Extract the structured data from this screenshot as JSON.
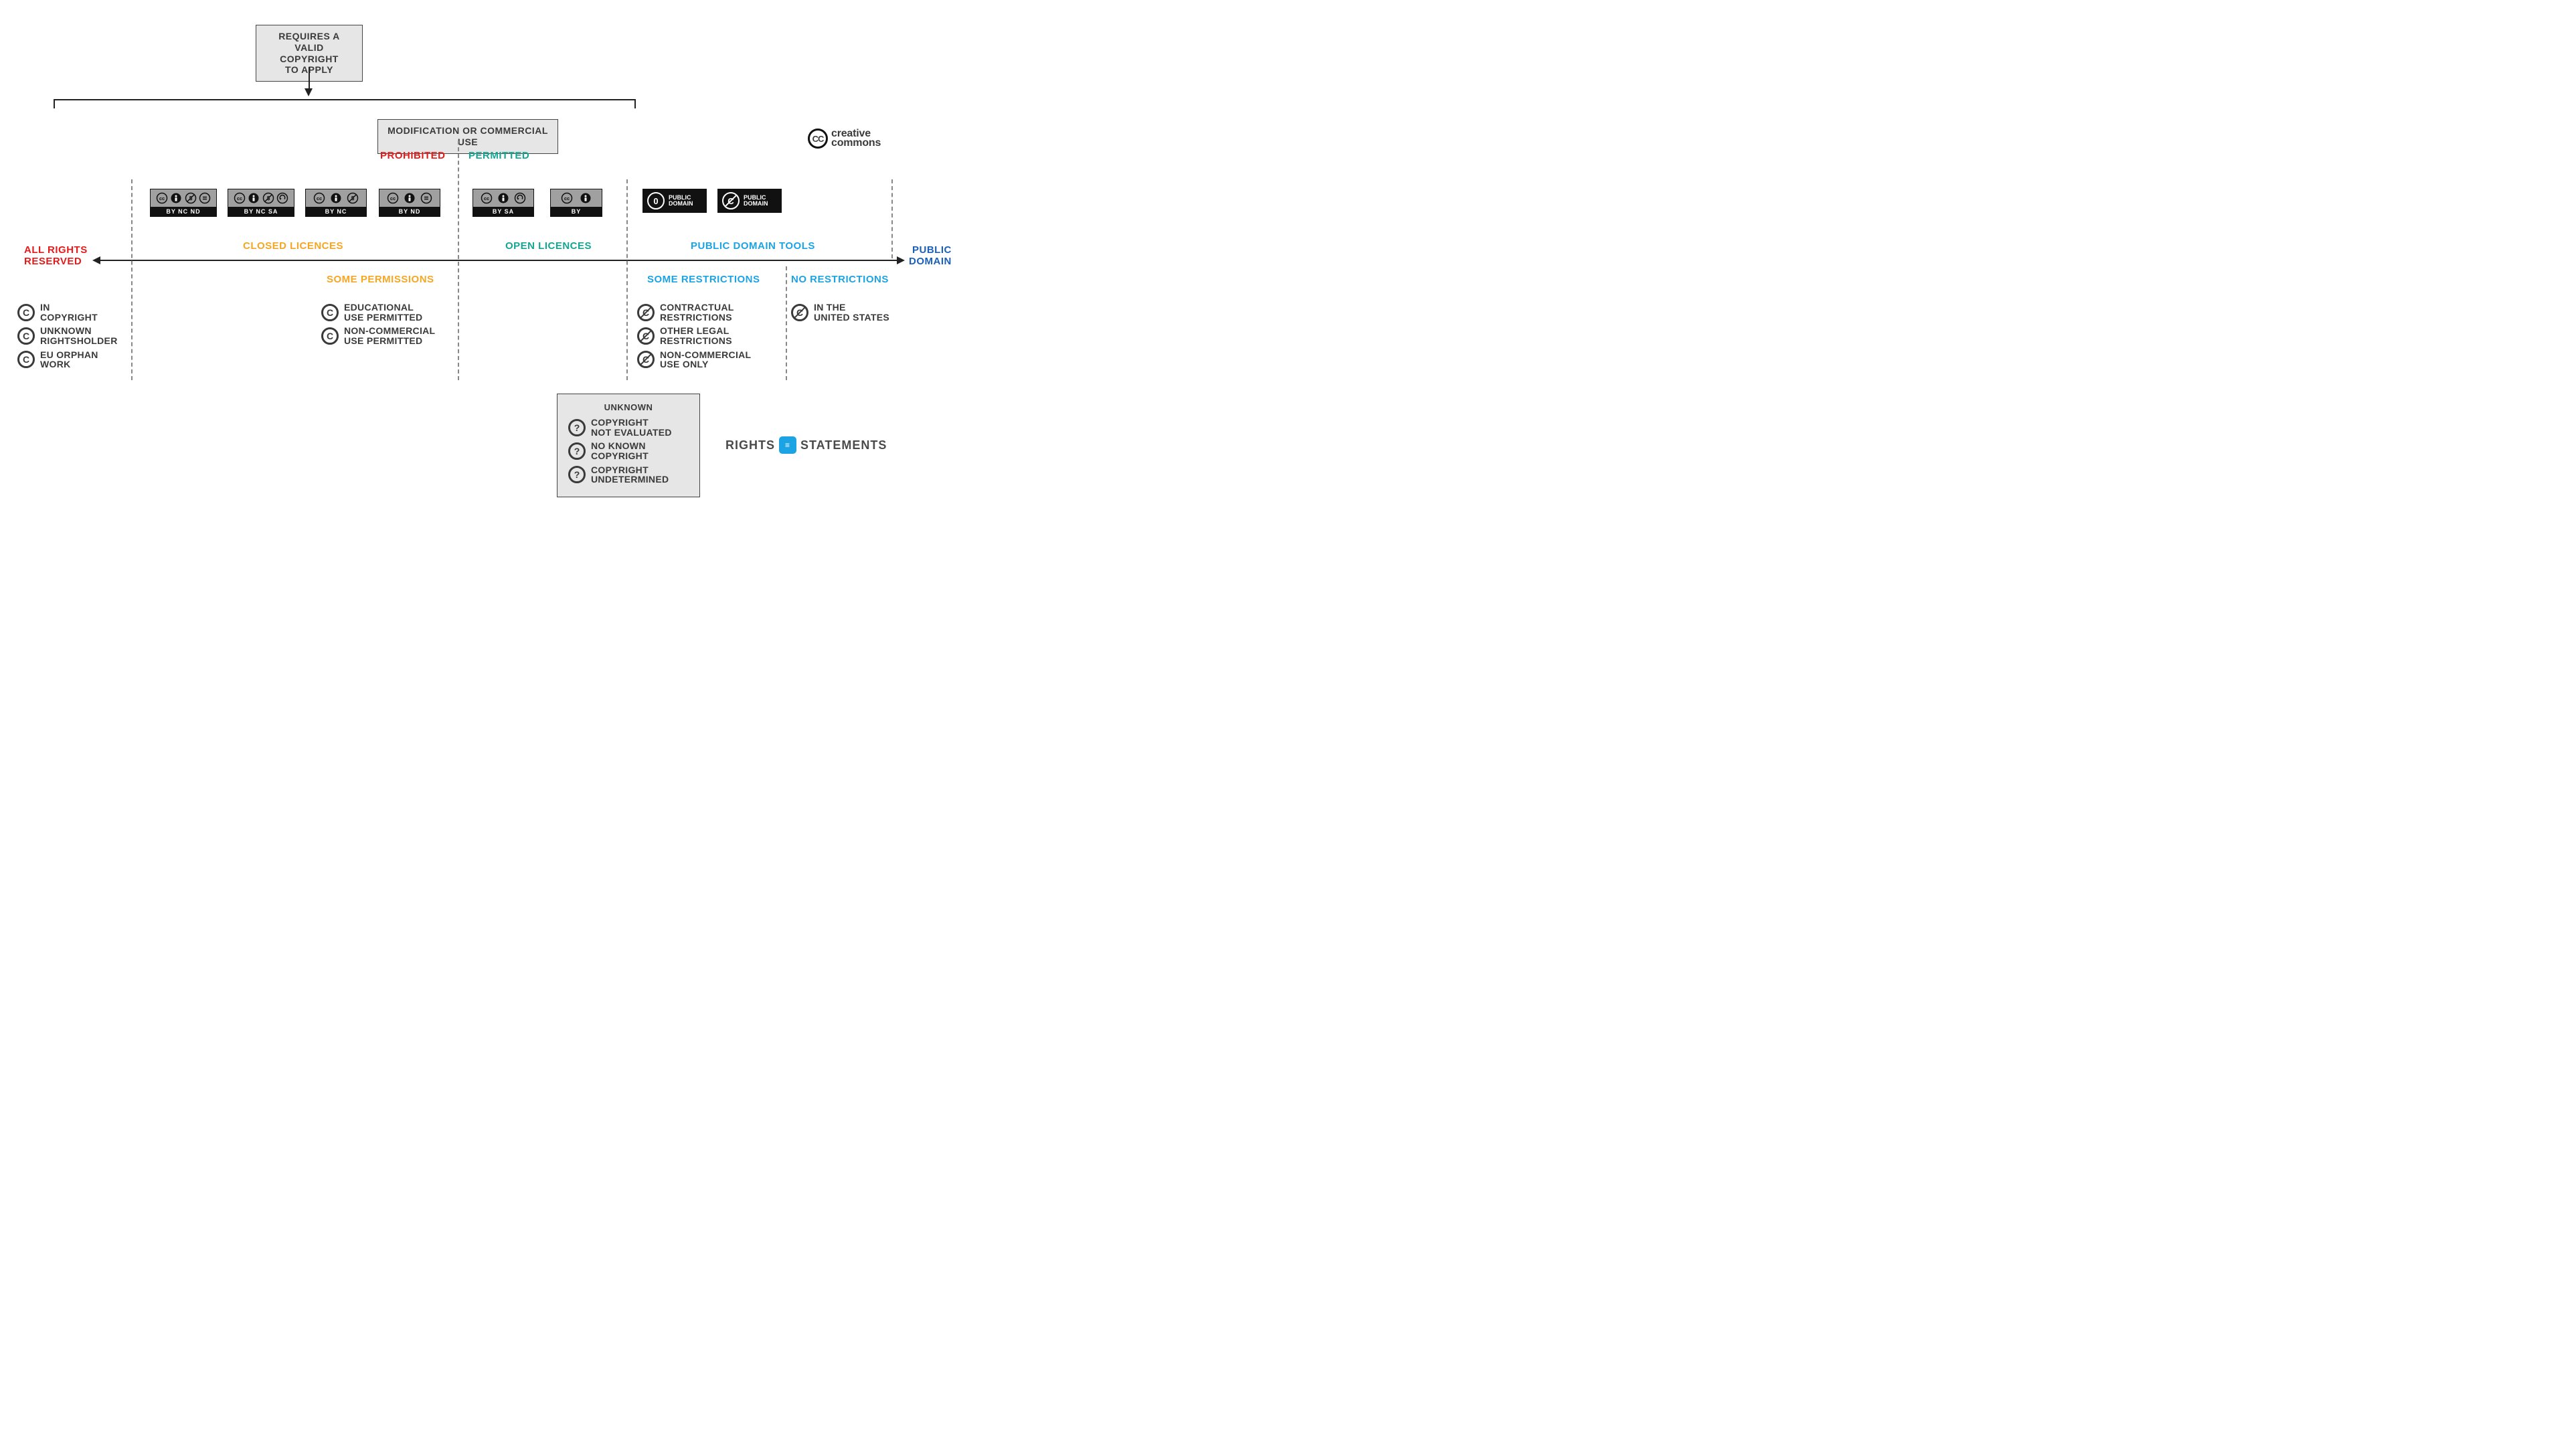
{
  "topBox": {
    "line1": "REQUIRES A",
    "line2": "VALID COPYRIGHT",
    "line3": "TO APPLY"
  },
  "midBox": "MODIFICATION OR COMMERCIAL USE",
  "prohibited": "PROHIBITED",
  "permitted": "PERMITTED",
  "ccLogo": {
    "mark": "CC",
    "line1": "creative",
    "line2": "commons"
  },
  "licenses": {
    "byncnd": "BY    NC    ND",
    "byncsa": "BY    NC    SA",
    "bync": "BY        NC",
    "bynd": "BY        ND",
    "bysa": "BY        SA",
    "by": "BY"
  },
  "pd": {
    "label": "PUBLIC\nDOMAIN",
    "zero": "0",
    "c": "C"
  },
  "sections": {
    "closed": "CLOSED LICENCES",
    "open": "OPEN LICENCES",
    "pdtools": "PUBLIC DOMAIN TOOLS",
    "someperm": "SOME PERMISSIONS",
    "somerestr": "SOME RESTRICTIONS",
    "norestr": "NO RESTRICTIONS"
  },
  "leftEnd": {
    "line1": "ALL RIGHTS",
    "line2": "RESERVED"
  },
  "rightEnd": {
    "line1": "PUBLIC",
    "line2": "DOMAIN"
  },
  "col1": [
    {
      "glyph": "C",
      "text": "IN\nCOPYRIGHT"
    },
    {
      "glyph": "C",
      "text": "UNKNOWN\nRIGHTSHOLDER"
    },
    {
      "glyph": "C",
      "text": "EU ORPHAN\nWORK"
    }
  ],
  "col2": [
    {
      "glyph": "C",
      "text": "EDUCATIONAL\nUSE PERMITTED"
    },
    {
      "glyph": "C",
      "text": "NON-COMMERCIAL\nUSE PERMITTED"
    }
  ],
  "col3": [
    {
      "glyph": "C",
      "slash": true,
      "text": "CONTRACTUAL\nRESTRICTIONS"
    },
    {
      "glyph": "C",
      "slash": true,
      "text": "OTHER LEGAL\nRESTRICTIONS"
    },
    {
      "glyph": "C",
      "slash": true,
      "text": "NON-COMMERCIAL\nUSE ONLY"
    }
  ],
  "col4": [
    {
      "glyph": "C",
      "slash": true,
      "text": "IN THE\nUNITED STATES"
    }
  ],
  "unknown": {
    "title": "UNKNOWN",
    "items": [
      {
        "glyph": "?",
        "text": "COPYRIGHT\nNOT EVALUATED"
      },
      {
        "glyph": "?",
        "text": "NO KNOWN\nCOPYRIGHT"
      },
      {
        "glyph": "?",
        "text": "COPYRIGHT\nUNDETERMINED"
      }
    ]
  },
  "rsLogo": {
    "left": "RIGHTS",
    "right": "STATEMENTS"
  }
}
